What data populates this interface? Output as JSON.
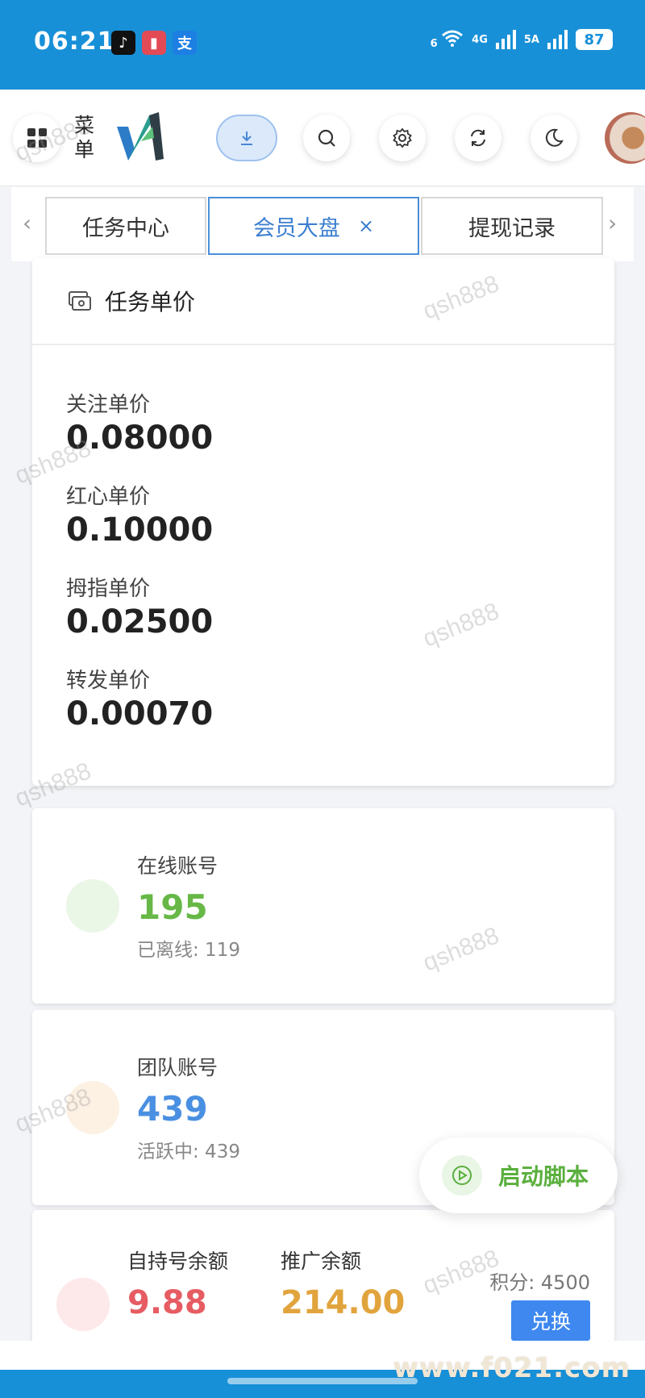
{
  "status_bar": {
    "time": "06:21",
    "apps": [
      "tiktok-icon",
      "book-icon",
      "alipay-icon"
    ],
    "alipay_glyph": "支",
    "wifi_badge": "6",
    "signal_1": "4G",
    "signal_2": "5A",
    "battery": "87"
  },
  "header": {
    "menu_label": "菜单"
  },
  "tabs": [
    {
      "label": "任务中心",
      "active": false
    },
    {
      "label": "会员大盘",
      "active": true,
      "close": "×"
    },
    {
      "label": "提现记录",
      "active": false
    }
  ],
  "task_price": {
    "title": "任务单价",
    "items": [
      {
        "label": "关注单价",
        "value": "0.08000"
      },
      {
        "label": "红心单价",
        "value": "0.10000"
      },
      {
        "label": "拇指单价",
        "value": "0.02500"
      },
      {
        "label": "转发单价",
        "value": "0.00070"
      }
    ]
  },
  "online_accounts": {
    "label": "在线账号",
    "value": "195",
    "sub": "已离线: 119",
    "color": "#67b846"
  },
  "team_accounts": {
    "label": "团队账号",
    "value": "439",
    "sub": "活跃中: 439",
    "color": "#4a90e2"
  },
  "balance": {
    "self_label": "自持号余额",
    "self_value": "9.88",
    "self_color": "#e65c62",
    "promo_label": "推广余额",
    "promo_value": "214.00",
    "promo_color": "#e1a43d",
    "points": "积分: 4500",
    "exchange_label": "兑换"
  },
  "float_button": {
    "label": "启动脚本"
  },
  "watermark": "qsh888",
  "site_mark": "www.f021.com"
}
